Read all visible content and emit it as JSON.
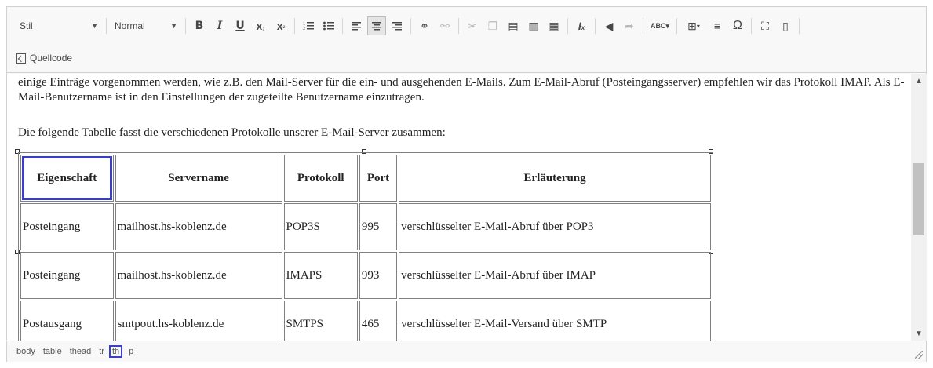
{
  "toolbar": {
    "style_combo": "Stil",
    "format_combo": "Normal",
    "source_label": "Quellcode",
    "buttons": {
      "bold": "B",
      "italic": "I",
      "underline": "U",
      "table_glyph": "⊞",
      "omega": "Ω"
    }
  },
  "content": {
    "para1": "einige Einträge vorgenommen werden, wie z.B. den Mail-Server für die ein- und ausgehenden E-Mails. Zum E-Mail-Abruf (Posteingangsserver) empfehlen wir das Protokoll IMAP. Als E-Mail-Benutzername ist in den Einstellungen der zugeteilte Benutzername einzutragen.",
    "para2": "Die folgende Tabelle fasst die verschiedenen Protokolle unserer E-Mail-Server zusammen:",
    "table": {
      "selected_header_before_caret": "Eige",
      "selected_header_after_caret": "nschaft",
      "headers": [
        "Eigenschaft",
        "Servername",
        "Protokoll",
        "Port",
        "Erläuterung"
      ],
      "rows": [
        [
          "Posteingang",
          "mailhost.hs-koblenz.de",
          "POP3S",
          "995",
          "verschlüsselter E-Mail-Abruf über POP3"
        ],
        [
          "Posteingang",
          "mailhost.hs-koblenz.de",
          "IMAPS",
          "993",
          "verschlüsselter E-Mail-Abruf über IMAP"
        ],
        [
          "Postausgang",
          "smtpout.hs-koblenz.de",
          "SMTPS",
          "465",
          "verschlüsselter E-Mail-Versand über SMTP"
        ]
      ]
    }
  },
  "statusbar": {
    "path": [
      "body",
      "table",
      "thead",
      "tr",
      "th",
      "p"
    ],
    "current": "th"
  },
  "colors": {
    "selection": "#3a3ec9"
  }
}
